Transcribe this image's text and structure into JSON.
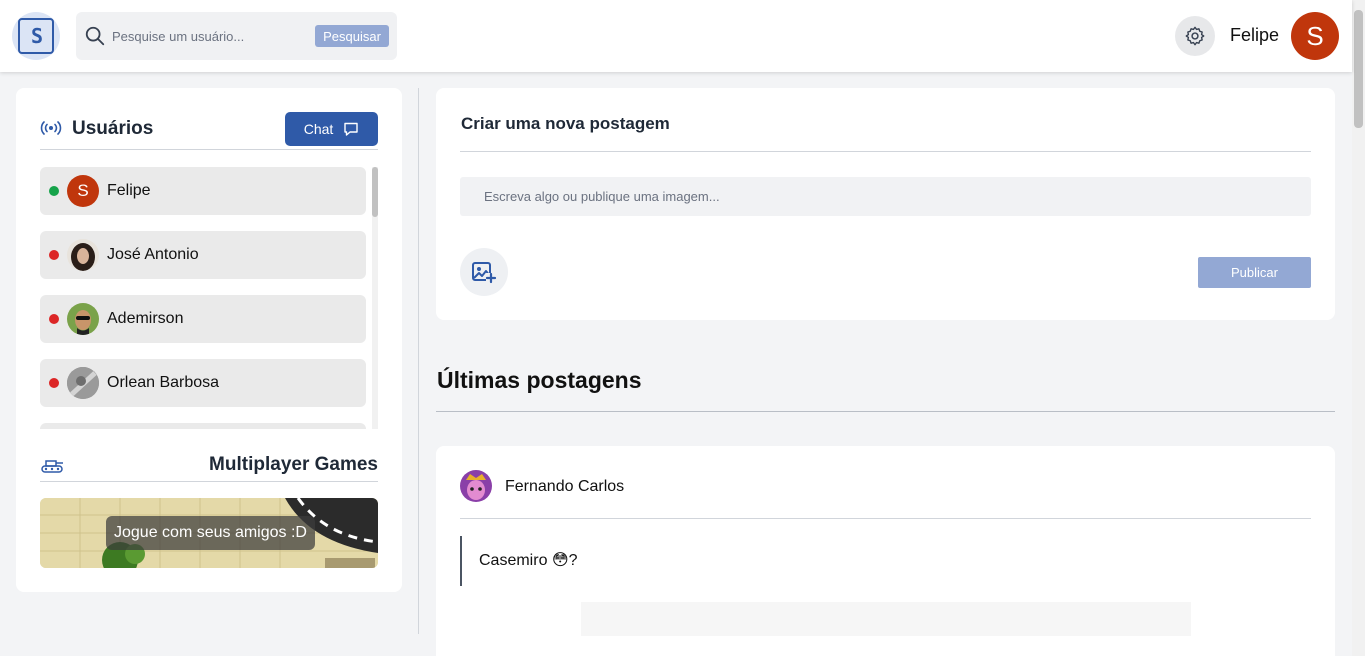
{
  "header": {
    "logo_text": "S",
    "search_placeholder": "Pesquise um usuário...",
    "search_button": "Pesquisar",
    "user_name": "Felipe",
    "user_initial": "S",
    "icons": [
      "search-icon",
      "gear-icon"
    ]
  },
  "sidebar": {
    "users_title": "Usuários",
    "chat_button": "Chat",
    "users": [
      {
        "name": "Felipe",
        "status": "online",
        "initial": "S"
      },
      {
        "name": "José Antonio",
        "status": "offline"
      },
      {
        "name": "Ademirson",
        "status": "offline"
      },
      {
        "name": "Orlean Barbosa",
        "status": "offline"
      }
    ],
    "games_title": "Multiplayer Games",
    "games_banner_text": "Jogue com seus amigos :D"
  },
  "create_post": {
    "title": "Criar uma nova postagem",
    "input_placeholder": "Escreva algo ou publique uma imagem...",
    "publish_button": "Publicar"
  },
  "feed": {
    "title": "Últimas postagens",
    "posts": [
      {
        "author": "Fernando Carlos",
        "text": "Casemiro 😳?"
      }
    ]
  },
  "colors": {
    "primary": "#2f5aa8",
    "primary_muted": "#93a8d4",
    "online": "#16a34a",
    "offline": "#dc2626",
    "avatar_bg": "#c0360c",
    "page_bg": "#f3f4f6"
  }
}
